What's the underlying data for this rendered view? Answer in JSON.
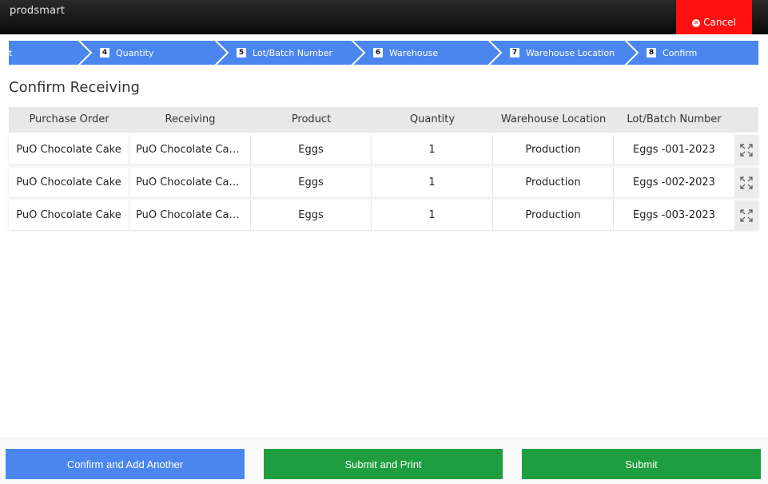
{
  "app": {
    "brand": "prodsmart"
  },
  "header": {
    "cancel_label": "Cancel"
  },
  "steps": [
    {
      "num": "",
      "label": "t"
    },
    {
      "num": "4",
      "label": "Quantity"
    },
    {
      "num": "5",
      "label": "Lot/Batch Number"
    },
    {
      "num": "6",
      "label": "Warehouse"
    },
    {
      "num": "7",
      "label": "Warehouse Location"
    },
    {
      "num": "8",
      "label": "Confirm"
    }
  ],
  "page": {
    "title": "Confirm Receiving"
  },
  "table": {
    "columns": [
      "Purchase Order",
      "Receiving",
      "Product",
      "Quantity",
      "Warehouse Location",
      "Lot/Batch Number"
    ],
    "rows": [
      {
        "purchase_order": "PuO Chocolate Cake",
        "receiving": "PuO Chocolate Cak...",
        "product": "Eggs",
        "quantity": "1",
        "warehouse_location": "Production",
        "lot": "Eggs -001-2023"
      },
      {
        "purchase_order": "PuO Chocolate Cake",
        "receiving": "PuO Chocolate Cak...",
        "product": "Eggs",
        "quantity": "1",
        "warehouse_location": "Production",
        "lot": "Eggs -002-2023"
      },
      {
        "purchase_order": "PuO Chocolate Cake",
        "receiving": "PuO Chocolate Cak...",
        "product": "Eggs",
        "quantity": "1",
        "warehouse_location": "Production",
        "lot": "Eggs -003-2023"
      }
    ]
  },
  "footer": {
    "confirm_add_label": "Confirm and Add Another",
    "submit_print_label": "Submit and Print",
    "submit_label": "Submit"
  },
  "colors": {
    "step_blue": "#4b86ef",
    "cancel_red": "#ff1010",
    "submit_green": "#1e9e40",
    "topbar_black": "#111111"
  },
  "icons": {
    "cancel": "close-circle-icon",
    "expand": "expand-icon",
    "step_separator": "chevron-right-icon"
  }
}
